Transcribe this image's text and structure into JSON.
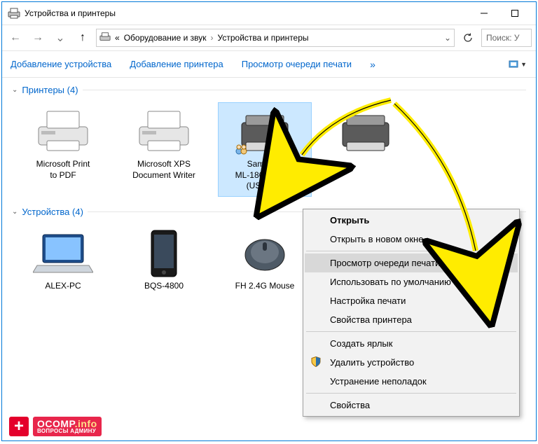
{
  "titlebar": {
    "title": "Устройства и принтеры"
  },
  "breadcrumb": {
    "dropdown_hint": "«",
    "part1": "Оборудование и звук",
    "part2": "Устройства и принтеры"
  },
  "nav": {
    "refresh_chev": "⌄"
  },
  "search": {
    "placeholder": "Поиск: У"
  },
  "toolbar": {
    "add_device": "Добавление устройства",
    "add_printer": "Добавление принтера",
    "view_queue": "Просмотр очереди печати",
    "more": "»"
  },
  "groups": {
    "printers": {
      "header": "Принтеры (4)"
    },
    "devices": {
      "header": "Устройства (4)"
    }
  },
  "printers": [
    {
      "label": "Microsoft Print\nto PDF"
    },
    {
      "label": "Microsoft XPS\nDocument Writer"
    },
    {
      "label": "Samsung\nML-1860 Series\n(USB001)",
      "selected": true,
      "shared": true
    },
    {
      "label": ""
    }
  ],
  "devices": [
    {
      "label": "ALEX-PC"
    },
    {
      "label": "BQS-4800"
    },
    {
      "label": "FH 2.4G Mouse"
    }
  ],
  "context_menu": {
    "open": "Открыть",
    "open_new_window": "Открыть в новом окне",
    "view_queue": "Просмотр очереди печати",
    "set_default": "Использовать по умолчанию",
    "printing_prefs": "Настройка печати",
    "printer_props": "Свойства принтера",
    "create_shortcut": "Создать ярлык",
    "remove_device": "Удалить устройство",
    "troubleshoot": "Устранение неполадок",
    "properties": "Свойства"
  },
  "watermark": {
    "brand": "OCOMP",
    "dot": ".info",
    "sub": "ВОПРОСЫ АДМИНУ",
    "plus": "+"
  }
}
